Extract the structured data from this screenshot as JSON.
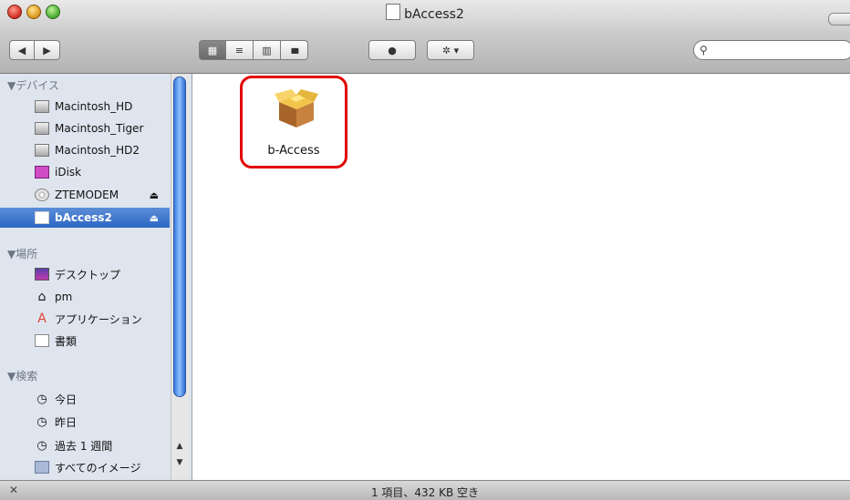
{
  "window": {
    "title": "bAccess2"
  },
  "toolbar": {
    "back": "◀",
    "forward": "▶",
    "view_icon": "▦",
    "view_list": "≡",
    "view_column": "▥",
    "view_coverflow": "▮▮▮",
    "quicklook": "●",
    "action": "✲ ▾",
    "search_placeholder": ""
  },
  "sidebar": {
    "devices_header": "▼デバイス",
    "devices": [
      {
        "label": "Macintosh_HD",
        "icon": "hd-icon"
      },
      {
        "label": "Macintosh_Tiger",
        "icon": "hd-icon"
      },
      {
        "label": "Macintosh_HD2",
        "icon": "hd-icon"
      },
      {
        "label": "iDisk",
        "icon": "idisk-icon"
      },
      {
        "label": "ZTEMODEM",
        "icon": "cd-icon",
        "eject": "⏏"
      },
      {
        "label": "bAccess2",
        "icon": "disk-icon",
        "eject": "⏏"
      }
    ],
    "places_header": "▼場所",
    "places": [
      {
        "label": "デスクトップ",
        "icon": "desktop-icon"
      },
      {
        "label": "pm",
        "icon": "home-icon"
      },
      {
        "label": "アプリケーション",
        "icon": "applications-icon"
      },
      {
        "label": "書類",
        "icon": "documents-icon"
      }
    ],
    "search_header": "▼検索",
    "searches": [
      {
        "label": "今日",
        "icon": "clock-icon"
      },
      {
        "label": "昨日",
        "icon": "clock-icon"
      },
      {
        "label": "過去 1 週間",
        "icon": "clock-icon"
      },
      {
        "label": "すべてのイメージ",
        "icon": "smart-folder-icon"
      }
    ]
  },
  "main": {
    "files": [
      {
        "label": "b-Access",
        "icon": "package-icon"
      }
    ]
  },
  "status": {
    "text": "1 項目、432 KB 空き"
  },
  "colors": {
    "selection": "#2d66c4",
    "highlight_box": "#e10000"
  }
}
